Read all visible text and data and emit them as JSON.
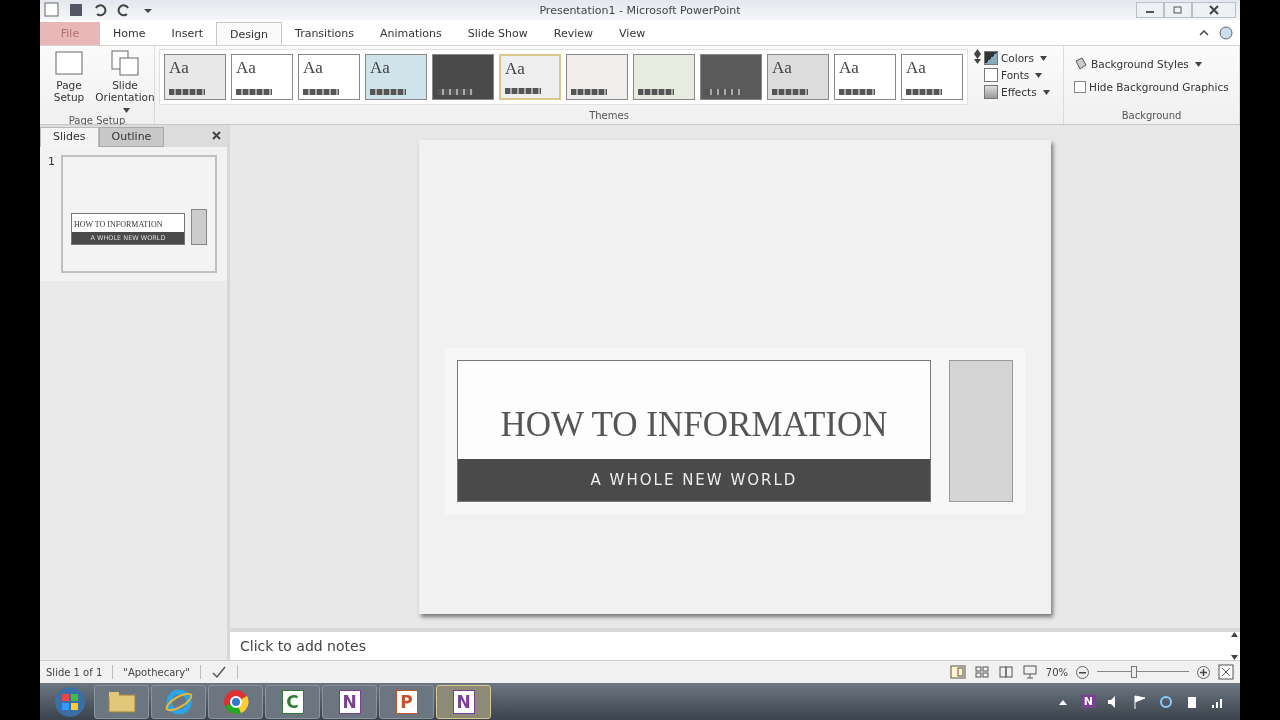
{
  "window": {
    "title": "Presentation1 - Microsoft PowerPoint"
  },
  "ribbon_tabs": [
    {
      "label": "File",
      "kind": "file",
      "selected": false
    },
    {
      "label": "Home",
      "kind": "tab",
      "selected": false
    },
    {
      "label": "Insert",
      "kind": "tab",
      "selected": false
    },
    {
      "label": "Design",
      "kind": "tab",
      "selected": true
    },
    {
      "label": "Transitions",
      "kind": "tab",
      "selected": false
    },
    {
      "label": "Animations",
      "kind": "tab",
      "selected": false
    },
    {
      "label": "Slide Show",
      "kind": "tab",
      "selected": false
    },
    {
      "label": "Review",
      "kind": "tab",
      "selected": false
    },
    {
      "label": "View",
      "kind": "tab",
      "selected": false
    }
  ],
  "page_setup": {
    "group_label": "Page Setup",
    "buttons": [
      {
        "label": "Page Setup",
        "kind": "page"
      },
      {
        "label": "Slide Orientation",
        "kind": "orientation"
      }
    ]
  },
  "themes": {
    "group_label": "Themes",
    "items": [
      {
        "label": "Aa",
        "color": "#e8e8e8",
        "selected": false
      },
      {
        "label": "Aa",
        "color": "#ffffff",
        "selected": false
      },
      {
        "label": "Aa",
        "color": "#ffffff",
        "selected": false
      },
      {
        "label": "Aa",
        "color": "#cfe3ea",
        "selected": false
      },
      {
        "color": "#4a4a4a",
        "selected": false
      },
      {
        "label": "Aa",
        "color": "#eeeeee",
        "selected": true
      },
      {
        "color": "#f2eeee",
        "selected": false
      },
      {
        "color": "#e6ecde",
        "selected": false
      },
      {
        "color": "#5a5a5a",
        "selected": false
      },
      {
        "label": "Aa",
        "color": "#dcdcdc",
        "selected": false
      },
      {
        "label": "Aa",
        "color": "#ffffff",
        "selected": false
      },
      {
        "label": "Aa",
        "color": "#ffffff",
        "selected": false
      }
    ]
  },
  "theme_options": [
    {
      "label": "Colors",
      "kind": "colors"
    },
    {
      "label": "Fonts",
      "kind": "fonts"
    },
    {
      "label": "Effects",
      "kind": "effects"
    }
  ],
  "background": {
    "group_label": "Background",
    "styles_label": "Background Styles",
    "hide_graphics": {
      "label": "Hide Background Graphics",
      "checked": false
    }
  },
  "slides_pane": {
    "tabs": [
      {
        "label": "Slides",
        "selected": true
      },
      {
        "label": "Outline",
        "selected": false
      }
    ],
    "thumbnails": [
      {
        "number": "1",
        "title": "HOW TO INFORMATION",
        "subtitle": "A WHOLE NEW WORLD",
        "selected": true
      }
    ]
  },
  "slide": {
    "title": "HOW TO INFORMATION",
    "subtitle": "A WHOLE NEW WORLD"
  },
  "notes": {
    "placeholder": "Click to add notes"
  },
  "status_bar": {
    "slide": "Slide 1 of 1",
    "theme": "\"Apothecary\"",
    "zoom": "70%",
    "zoom_slider": {
      "level": 0.4
    }
  },
  "taskbar": [
    {
      "kind": "folder",
      "selected": false
    },
    {
      "kind": "ie",
      "selected": false
    },
    {
      "kind": "chrome",
      "selected": false
    },
    {
      "kind": "letter",
      "label": "C",
      "color": "#2e7d32",
      "selected": false
    },
    {
      "kind": "letter",
      "label": "N",
      "color": "#7b3f98",
      "selected": false
    },
    {
      "kind": "letter",
      "label": "P",
      "color": "#c8502a",
      "selected": false
    },
    {
      "kind": "letter",
      "label": "N",
      "color": "#7b3f98",
      "selected": true
    }
  ],
  "tray": {
    "onenote": "N"
  }
}
